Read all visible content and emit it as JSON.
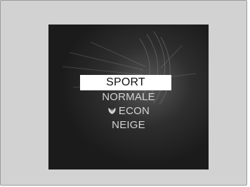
{
  "drive_mode_menu": {
    "items": [
      {
        "label": "SPORT",
        "selected": true
      },
      {
        "label": "NORMALE",
        "selected": false
      },
      {
        "label": "ECON",
        "icon": "leaf-icon",
        "selected": false
      },
      {
        "label": "NEIGE",
        "selected": false
      }
    ]
  },
  "colors": {
    "screen_background": "#1b1b1b",
    "selected_highlight": "#ffffff",
    "text": "#d4d4d4"
  }
}
